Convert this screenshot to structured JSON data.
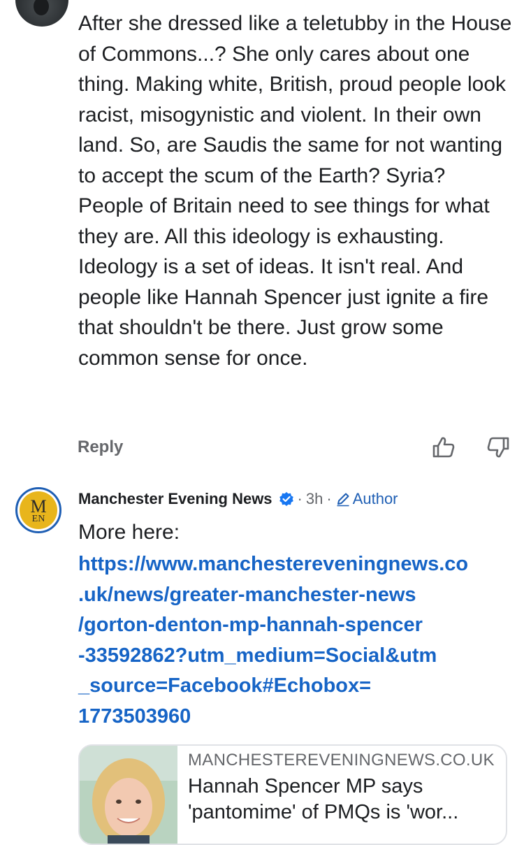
{
  "previous_comment": {
    "text": "After she dressed like a teletubby in the House of Commons...? She only cares about one thing. Making white, British, proud people look racist, misogynistic and violent. In their own land. So, are Saudis the same for not wanting to accept the scum of the Earth? Syria? People of Britain need to see things for what they are. All this ideology is exhausting. Ideology is a set of ideas. It isn't real. And people like Hannah Spencer just ignite a fire that shouldn't be there. Just grow some common sense for once.",
    "reply_label": "Reply",
    "like_icon": "thumb-up-icon",
    "dislike_icon": "thumb-down-icon"
  },
  "author_comment": {
    "avatar_letters_top": "M",
    "avatar_letters_bottom": "EN",
    "author_name": "Manchester Evening News",
    "separator": "·",
    "time": "3h",
    "author_badge": "Author",
    "intro": "More here:",
    "link_lines": [
      "https://www.manchestereveningnews.co",
      ".uk/news/greater-manchester-news",
      "/gorton-denton-mp-hannah-spencer",
      "-33592862?utm_medium=Social&utm",
      "_source=Facebook#Echobox=",
      "1773503960"
    ],
    "preview": {
      "domain": "MANCHESTEREVENINGNEWS.CO.UK",
      "title_line1": "Hannah Spencer MP says",
      "title_line2": "'pantomime' of PMQs is 'wor..."
    }
  },
  "colors": {
    "link": "#1664c6",
    "muted": "#65676b",
    "verified": "#1877f2",
    "avatar_ring": "#1f5fb4",
    "avatar_fill": "#e8b51c"
  }
}
